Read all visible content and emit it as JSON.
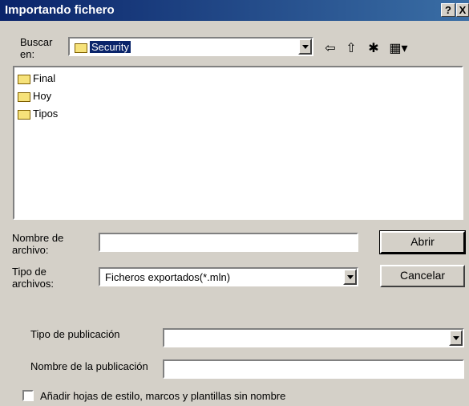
{
  "window": {
    "title": "Importando fichero",
    "help_btn": "?",
    "close_btn": "X"
  },
  "lookin": {
    "label": "Buscar en:",
    "value": "Security"
  },
  "toolbar": {
    "back_glyph": "⇦",
    "up_glyph": "⇧",
    "newfolder_glyph": "✱",
    "view_glyph": "▦▾"
  },
  "files": [
    {
      "name": "Final"
    },
    {
      "name": "Hoy"
    },
    {
      "name": "Tipos"
    }
  ],
  "filename": {
    "label": "Nombre de archivo:",
    "value": ""
  },
  "filetype": {
    "label": "Tipo de archivos:",
    "value": "Ficheros exportados(*.mln)"
  },
  "buttons": {
    "open": "Abrir",
    "cancel": "Cancelar"
  },
  "pub": {
    "type_label": "Tipo de publicación",
    "type_value": "",
    "name_label": "Nombre de la publicación",
    "name_value": ""
  },
  "checkbox": {
    "label": "Añadir hojas de estilo, marcos y plantillas sin nombre",
    "checked": false
  }
}
